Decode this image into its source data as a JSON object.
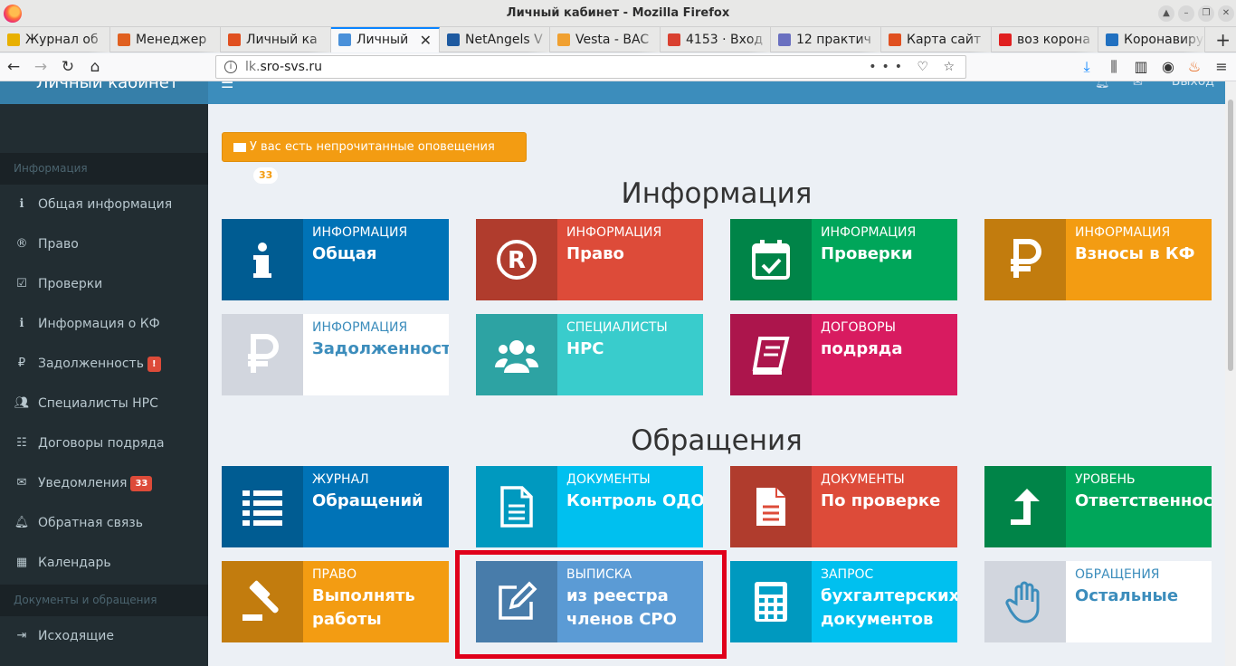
{
  "window": {
    "title": "Личный кабинет - Mozilla Firefox"
  },
  "tabs": [
    {
      "label": "Журнал об",
      "color": "#e8b000"
    },
    {
      "label": "Менеджер",
      "color": "#e06020"
    },
    {
      "label": "Личный ка",
      "color": "#e05020"
    },
    {
      "label": "Личный",
      "color": "#4a90d9",
      "active": true
    },
    {
      "label": "NetAngels V",
      "color": "#1e5aa0"
    },
    {
      "label": "Vesta - BAC",
      "color": "#f0a030"
    },
    {
      "label": "4153 · Вход",
      "color": "#d94030"
    },
    {
      "label": "12 практич",
      "color": "#6a70c0"
    },
    {
      "label": "Карта сайт",
      "color": "#e05020"
    },
    {
      "label": "воз корона",
      "color": "#e02020"
    },
    {
      "label": "Коронавиру",
      "color": "#2070c0"
    }
  ],
  "url": {
    "host_gray": "lk.",
    "host": "sro-svs.ru"
  },
  "app": {
    "logo_text": "Личный кабинет",
    "exit_label": "Выход"
  },
  "sidebar": {
    "header_info": "Информация",
    "header_docs": "Документы и обращения",
    "items": [
      {
        "label": "Общая информация",
        "icon": "info-icon"
      },
      {
        "label": "Право",
        "icon": "registered-icon"
      },
      {
        "label": "Проверки",
        "icon": "calendar-check-icon"
      },
      {
        "label": "Информация о КФ",
        "icon": "info-icon"
      },
      {
        "label": "Задолженность",
        "icon": "ruble-icon",
        "badge": "!"
      },
      {
        "label": "Специалисты НРС",
        "icon": "users-icon"
      },
      {
        "label": "Договоры подряда",
        "icon": "list-icon"
      },
      {
        "label": "Уведомления",
        "icon": "envelope-icon",
        "badge": "33"
      },
      {
        "label": "Обратная связь",
        "icon": "bell-icon"
      },
      {
        "label": "Календарь",
        "icon": "calendar-icon"
      }
    ],
    "outgoing": {
      "label": "Исходящие",
      "icon": "sign-out-icon"
    }
  },
  "alert": {
    "label": "У вас есть непрочитанные оповещения",
    "count": "33"
  },
  "sections": {
    "info": "Информация",
    "requests": "Обращения"
  },
  "tiles_info": [
    {
      "top": "Информация",
      "value": "Общая",
      "color": "#0073b7",
      "icon": "info-icon"
    },
    {
      "top": "Информация",
      "value": "Право",
      "color": "#dd4b39",
      "icon": "registered-icon"
    },
    {
      "top": "Информация",
      "value": "Проверки",
      "color": "#00a65a",
      "icon": "calendar-check-icon"
    },
    {
      "top": "Информация",
      "value": "Взносы в КФ",
      "color": "#f39c12",
      "icon": "ruble-icon"
    },
    {
      "top": "Информация",
      "value": "Задолженность",
      "color": "#ffffff",
      "icon": "ruble-icon",
      "white": true
    },
    {
      "top": "Специалисты",
      "value": "НРС",
      "color": "#39cccc",
      "icon": "users-icon"
    },
    {
      "top": "Договоры",
      "value": "подряда",
      "color": "#d81b60",
      "icon": "book-icon"
    }
  ],
  "tiles_requests": [
    {
      "top": "Журнал",
      "value": "Обращений",
      "color": "#0073b7",
      "icon": "list-icon"
    },
    {
      "top": "Документы",
      "value": "Контроль ОДО",
      "color": "#00c0ef",
      "icon": "file-text-icon"
    },
    {
      "top": "Документы",
      "value": "По проверке",
      "color": "#dd4b39",
      "icon": "file-icon"
    },
    {
      "top": "Уровень",
      "value": "Ответственности",
      "color": "#00a65a",
      "icon": "level-up-icon"
    },
    {
      "top": "Право",
      "value": "Выполнять",
      "value2": "работы",
      "color": "#f39c12",
      "icon": "gavel-icon"
    },
    {
      "top": "Выписка",
      "value": "из реестра",
      "value2": "членов СРО",
      "color": "#5b9bd5",
      "icon": "edit-icon"
    },
    {
      "top": "Запрос",
      "value": "бухгалтерских",
      "value2": "документов",
      "color": "#00c0ef",
      "icon": "calculator-icon"
    },
    {
      "top": "Обращения",
      "value": "Остальные",
      "color": "#ffffff",
      "icon": "hand-icon",
      "white": true
    }
  ]
}
